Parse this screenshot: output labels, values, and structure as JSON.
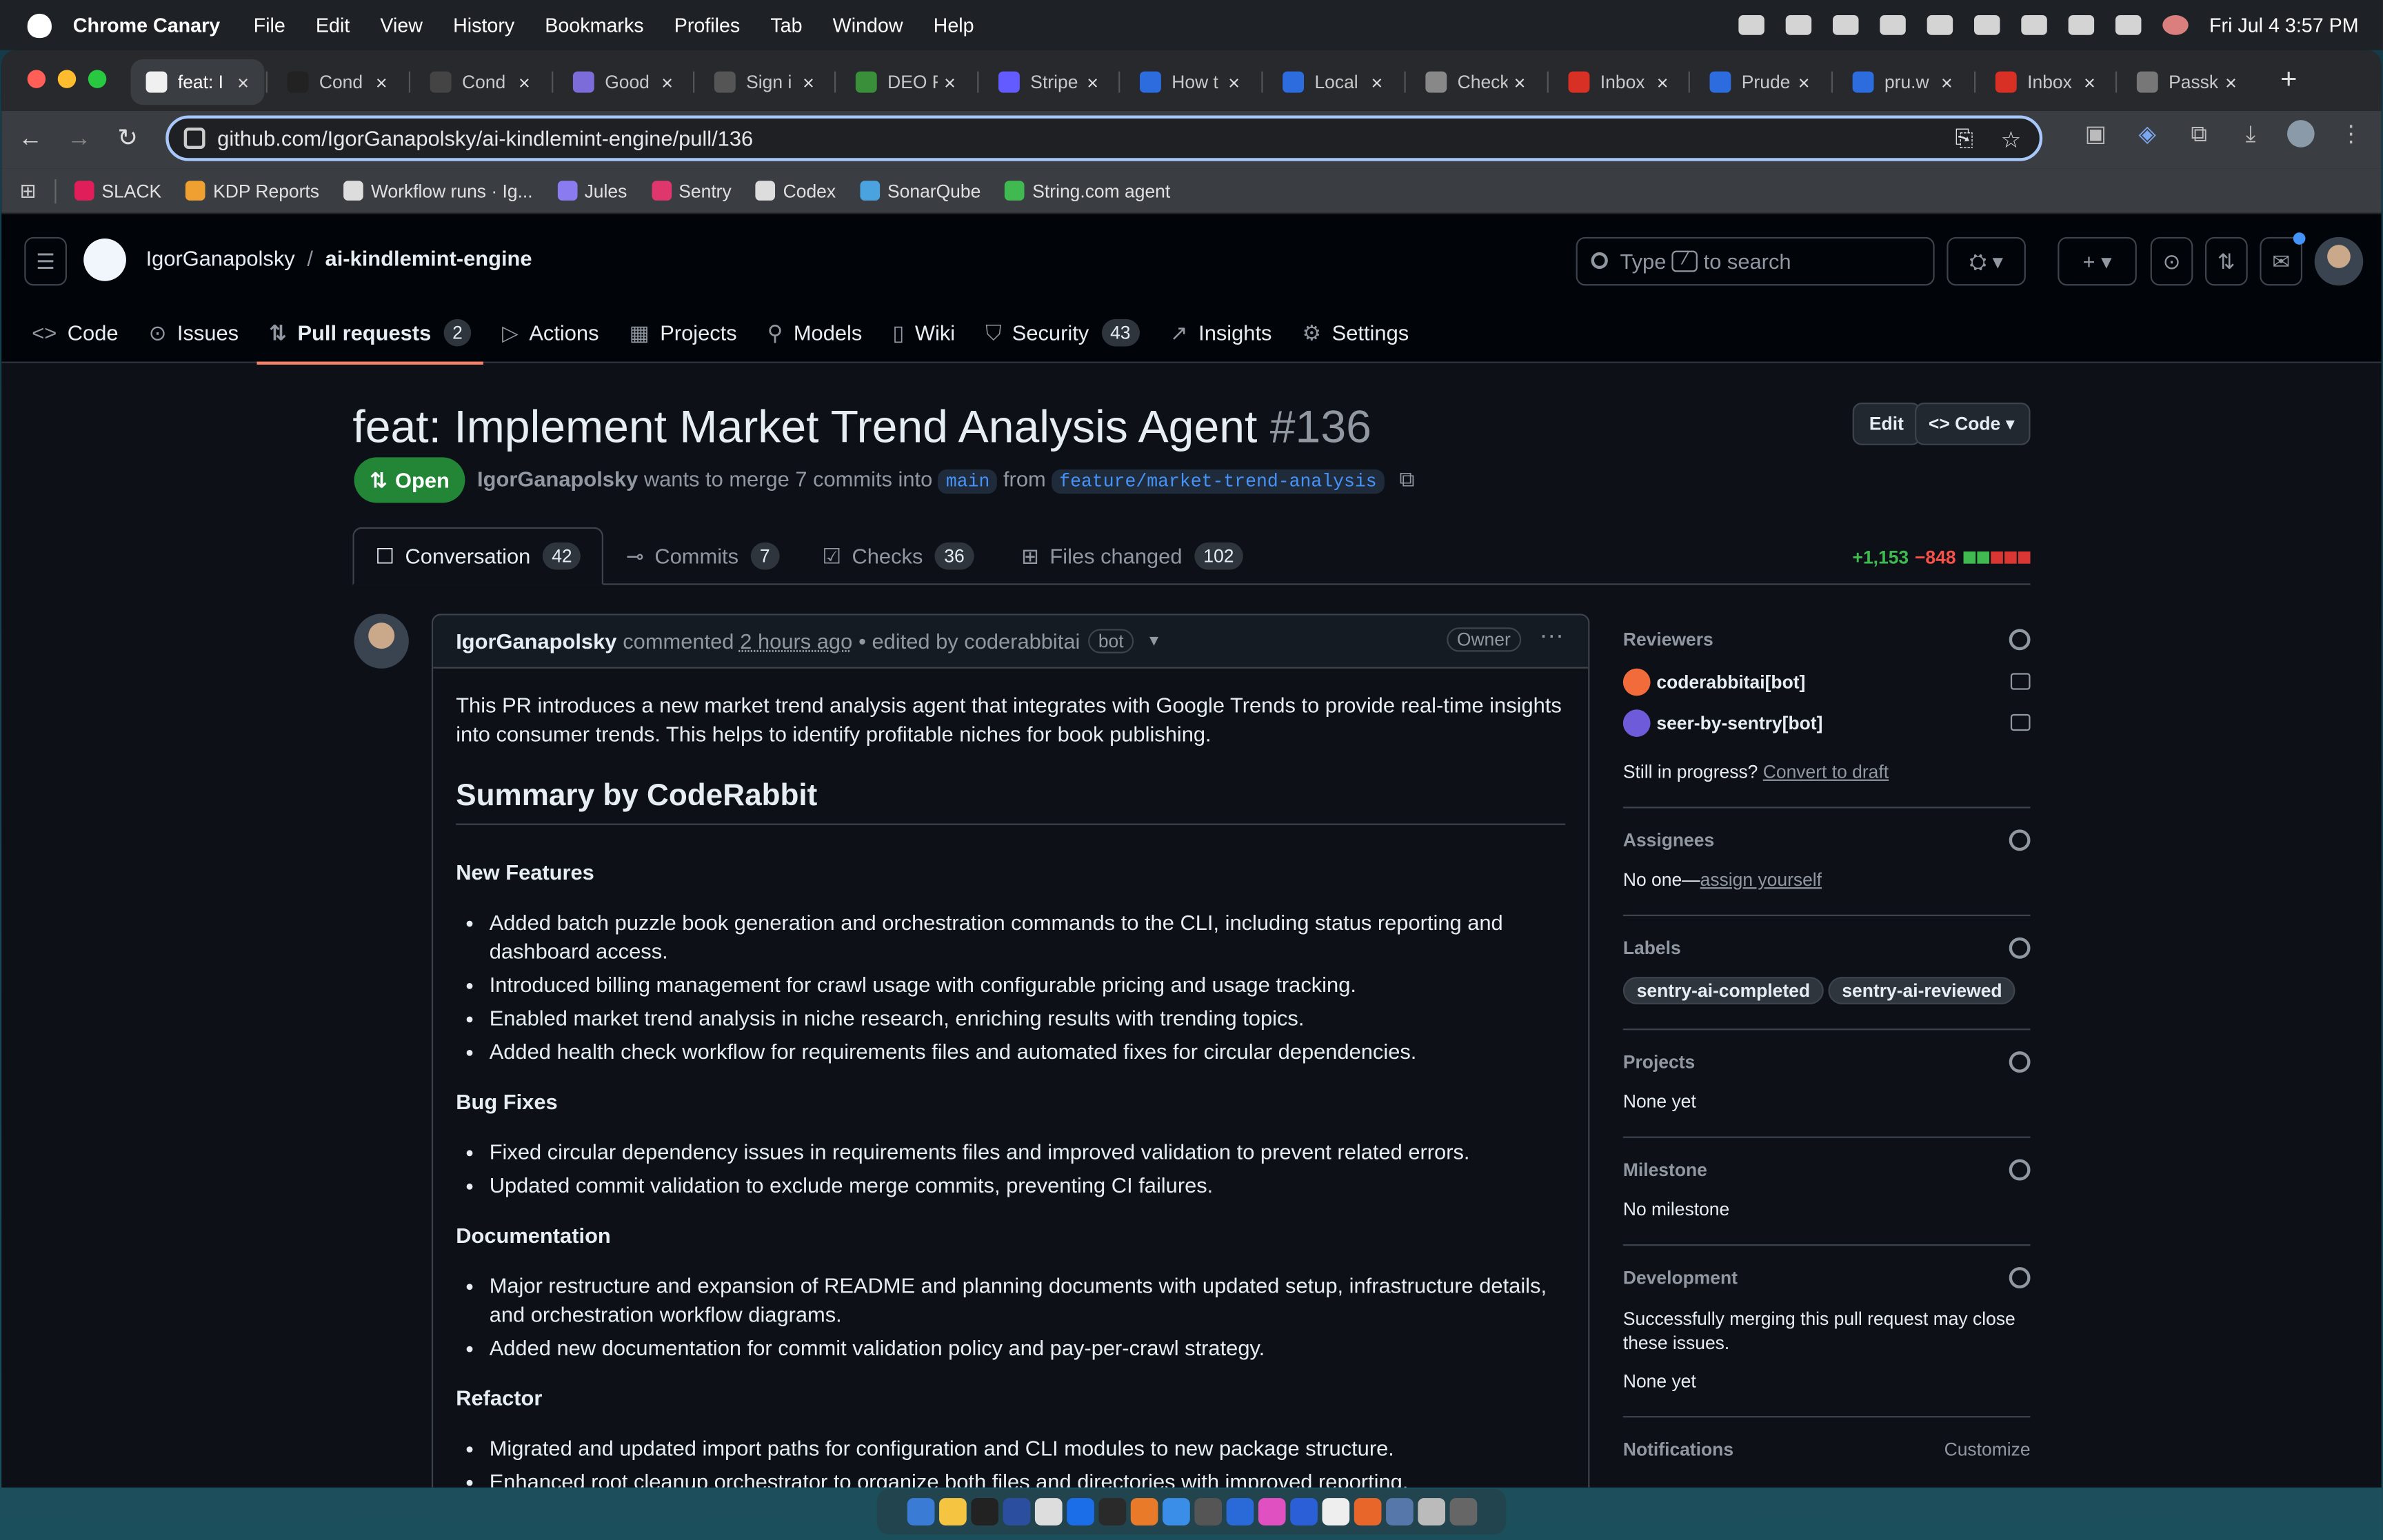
{
  "menubar": {
    "app": "Chrome Canary",
    "items": [
      "File",
      "Edit",
      "View",
      "History",
      "Bookmarks",
      "Profiles",
      "Tab",
      "Window",
      "Help"
    ],
    "datetime": "Fri Jul 4  3:57 PM"
  },
  "tabs": [
    {
      "title": "feat: I",
      "color": "#f0f0f0"
    },
    {
      "title": "Cond",
      "color": "#222"
    },
    {
      "title": "Cond",
      "color": "#444"
    },
    {
      "title": "Good",
      "color": "#7b6cd9"
    },
    {
      "title": "Sign i",
      "color": "#555"
    },
    {
      "title": "DEO F",
      "color": "#3a8f3a"
    },
    {
      "title": "Stripe",
      "color": "#635bff"
    },
    {
      "title": "How t",
      "color": "#2d6cdf"
    },
    {
      "title": "Local",
      "color": "#2d6cdf"
    },
    {
      "title": "Check",
      "color": "#888"
    },
    {
      "title": "Inbox",
      "color": "#d93025"
    },
    {
      "title": "Prude",
      "color": "#2d6cdf"
    },
    {
      "title": "pru.w",
      "color": "#2d6cdf"
    },
    {
      "title": "Inbox",
      "color": "#d93025"
    },
    {
      "title": "Passk",
      "color": "#777"
    }
  ],
  "address": {
    "url": "github.com/IgorGanapolsky/ai-kindlemint-engine/pull/136"
  },
  "bookmarks": [
    {
      "label": "SLACK",
      "color": "#e01e5a"
    },
    {
      "label": "KDP Reports",
      "color": "#f0a030"
    },
    {
      "label": "Workflow runs · Ig...",
      "color": "#ddd"
    },
    {
      "label": "Jules",
      "color": "#8a7cf0"
    },
    {
      "label": "Sentry",
      "color": "#e0366e"
    },
    {
      "label": "Codex",
      "color": "#ddd"
    },
    {
      "label": "SonarQube",
      "color": "#4aa3df"
    },
    {
      "label": "String.com agent",
      "color": "#3fb950"
    }
  ],
  "repo": {
    "owner": "IgorGanapolsky",
    "sep": "/",
    "name": "ai-kindlemint-engine"
  },
  "search": {
    "prefix": "Type",
    "key": "/",
    "suffix": "to search"
  },
  "repo_nav": [
    {
      "label": "Code",
      "icon": "<>"
    },
    {
      "label": "Issues",
      "icon": "⊙"
    },
    {
      "label": "Pull requests",
      "icon": "⇅",
      "count": "2"
    },
    {
      "label": "Actions",
      "icon": "▷"
    },
    {
      "label": "Projects",
      "icon": "▦"
    },
    {
      "label": "Models",
      "icon": "⚲"
    },
    {
      "label": "Wiki",
      "icon": "▯"
    },
    {
      "label": "Security",
      "icon": "⛉",
      "count": "43"
    },
    {
      "label": "Insights",
      "icon": "↗"
    },
    {
      "label": "Settings",
      "icon": "⚙"
    }
  ],
  "pr": {
    "title": "feat: Implement Market Trend Analysis Agent",
    "number": "#136",
    "edit_label": "Edit",
    "code_label": "Code",
    "state": "Open",
    "author": "IgorGanapolsky",
    "merge_text": "wants to merge 7 commits into",
    "base": "main",
    "from_text": "from",
    "head": "feature/market-trend-analysis"
  },
  "pr_tabs": [
    {
      "label": "Conversation",
      "count": "42"
    },
    {
      "label": "Commits",
      "count": "7"
    },
    {
      "label": "Checks",
      "count": "36"
    },
    {
      "label": "Files changed",
      "count": "102"
    }
  ],
  "diffstat": {
    "added": "+1,153",
    "removed": "−848"
  },
  "comment": {
    "author": "IgorGanapolsky",
    "action": "commented",
    "time": "2 hours ago",
    "edited": "• edited by coderabbitai",
    "bot": "bot",
    "role": "Owner",
    "intro": "This PR introduces a new market trend analysis agent that integrates with Google Trends to provide real-time insights into consumer trends. This helps to identify profitable niches for book publishing.",
    "summary_heading": "Summary by CodeRabbit",
    "sections": [
      {
        "heading": "New Features",
        "items": [
          "Added batch puzzle book generation and orchestration commands to the CLI, including status reporting and dashboard access.",
          "Introduced billing management for crawl usage with configurable pricing and usage tracking.",
          "Enabled market trend analysis in niche research, enriching results with trending topics.",
          "Added health check workflow for requirements files and automated fixes for circular dependencies."
        ]
      },
      {
        "heading": "Bug Fixes",
        "items": [
          "Fixed circular dependency issues in requirements files and improved validation to prevent related errors.",
          "Updated commit validation to exclude merge commits, preventing CI failures."
        ]
      },
      {
        "heading": "Documentation",
        "items": [
          "Major restructure and expansion of README and planning documents with updated setup, infrastructure details, and orchestration workflow diagrams.",
          "Added new documentation for commit validation policy and pay-per-crawl strategy."
        ]
      },
      {
        "heading": "Refactor",
        "items": [
          "Migrated and updated import paths for configuration and CLI modules to new package structure.",
          "Enhanced root cleanup orchestrator to organize both files and directories with improved reporting."
        ]
      }
    ]
  },
  "sidebar": {
    "reviewers": {
      "heading": "Reviewers",
      "list": [
        {
          "name": "coderabbitai[bot]",
          "color": "#f26b3a"
        },
        {
          "name": "seer-by-sentry[bot]",
          "color": "#6e5bd9"
        }
      ],
      "progress_text": "Still in progress?",
      "convert_label": "Convert to draft"
    },
    "assignees": {
      "heading": "Assignees",
      "none": "No one—",
      "assign_label": "assign yourself"
    },
    "labels": {
      "heading": "Labels",
      "list": [
        "sentry-ai-completed",
        "sentry-ai-reviewed"
      ]
    },
    "projects": {
      "heading": "Projects",
      "value": "None yet"
    },
    "milestone": {
      "heading": "Milestone",
      "value": "No milestone"
    },
    "development": {
      "heading": "Development",
      "desc": "Successfully merging this pull request may close these issues.",
      "value": "None yet"
    },
    "notifications": {
      "heading": "Notifications",
      "customize": "Customize"
    }
  }
}
